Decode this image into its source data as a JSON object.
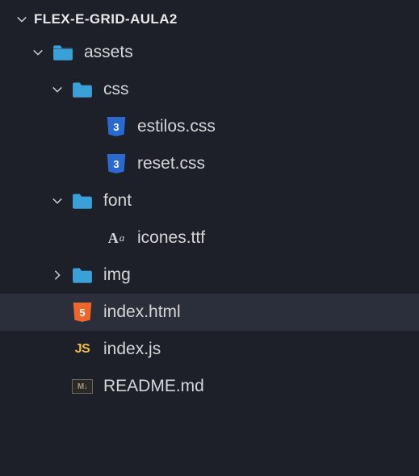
{
  "project": {
    "name": "FLEX-E-GRID-AULA2",
    "expanded": true
  },
  "tree": {
    "assets": {
      "label": "assets",
      "expanded": true,
      "children": {
        "css": {
          "label": "css",
          "expanded": true,
          "files": [
            {
              "label": "estilos.css",
              "icon": "css"
            },
            {
              "label": "reset.css",
              "icon": "css"
            }
          ]
        },
        "font": {
          "label": "font",
          "expanded": true,
          "files": [
            {
              "label": "icones.ttf",
              "icon": "font"
            }
          ]
        },
        "img": {
          "label": "img",
          "expanded": false
        }
      }
    },
    "root_files": [
      {
        "label": "index.html",
        "icon": "html",
        "selected": true
      },
      {
        "label": "index.js",
        "icon": "js"
      },
      {
        "label": "README.md",
        "icon": "md"
      }
    ]
  }
}
